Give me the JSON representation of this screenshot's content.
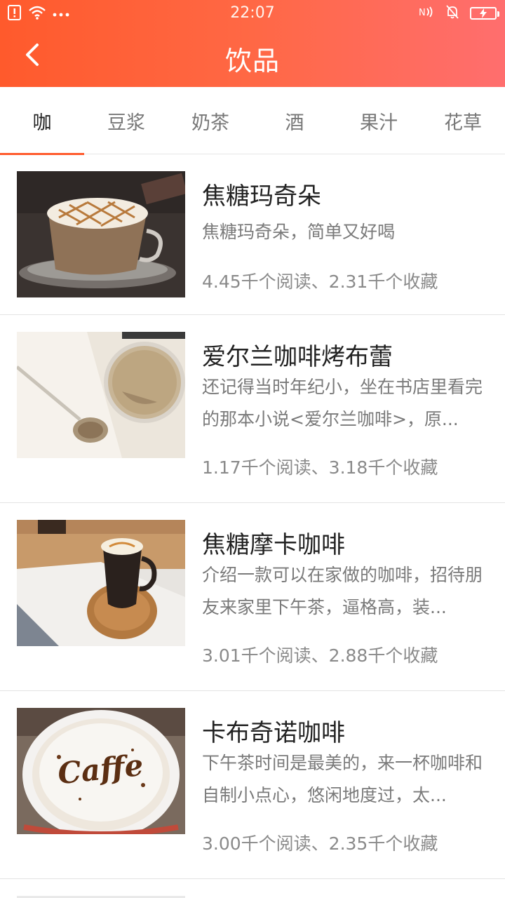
{
  "status_bar": {
    "time": "22:07",
    "icons_left": [
      "sim-alert-icon",
      "wifi-icon",
      "more-dots-icon"
    ],
    "icons_right": [
      "nfc-icon",
      "mute-bell-icon",
      "battery-charging-icon"
    ]
  },
  "header": {
    "title": "饮品",
    "back_icon": "back-arrow-icon",
    "gradient_colors": [
      "#ff5a2c",
      "#ff6e6e"
    ]
  },
  "tabs": [
    {
      "label": "咖",
      "active": true
    },
    {
      "label": "豆浆",
      "active": false
    },
    {
      "label": "奶茶",
      "active": false
    },
    {
      "label": "酒",
      "active": false
    },
    {
      "label": "果汁",
      "active": false
    },
    {
      "label": "花草",
      "active": false
    }
  ],
  "accent_color": "#ff5a2c",
  "items": [
    {
      "title": "焦糖玛奇朵",
      "desc": "焦糖玛奇朵，简单又好喝",
      "stats": "4.45千个阅读、2.31千个收藏",
      "image": "caramel-macchiato-photo"
    },
    {
      "title": "爱尔兰咖啡烤布蕾",
      "desc": "还记得当时年纪小，坐在书店里看完的那本小说<爱尔兰咖啡>，原...",
      "stats": "1.17千个阅读、3.18千个收藏",
      "image": "irish-coffee-creme-brulee-photo"
    },
    {
      "title": "焦糖摩卡咖啡",
      "desc": "介绍一款可以在家做的咖啡，招待朋友来家里下午茶，逼格高，装...",
      "stats": "3.01千个阅读、2.88千个收藏",
      "image": "caramel-mocha-photo"
    },
    {
      "title": "卡布奇诺咖啡",
      "desc": "下午茶时间是最美的，来一杯咖啡和自制小点心，悠闲地度过，太...",
      "stats": "3.00千个阅读、2.35千个收藏",
      "image": "cappuccino-photo",
      "image_text": "Caffe"
    }
  ]
}
